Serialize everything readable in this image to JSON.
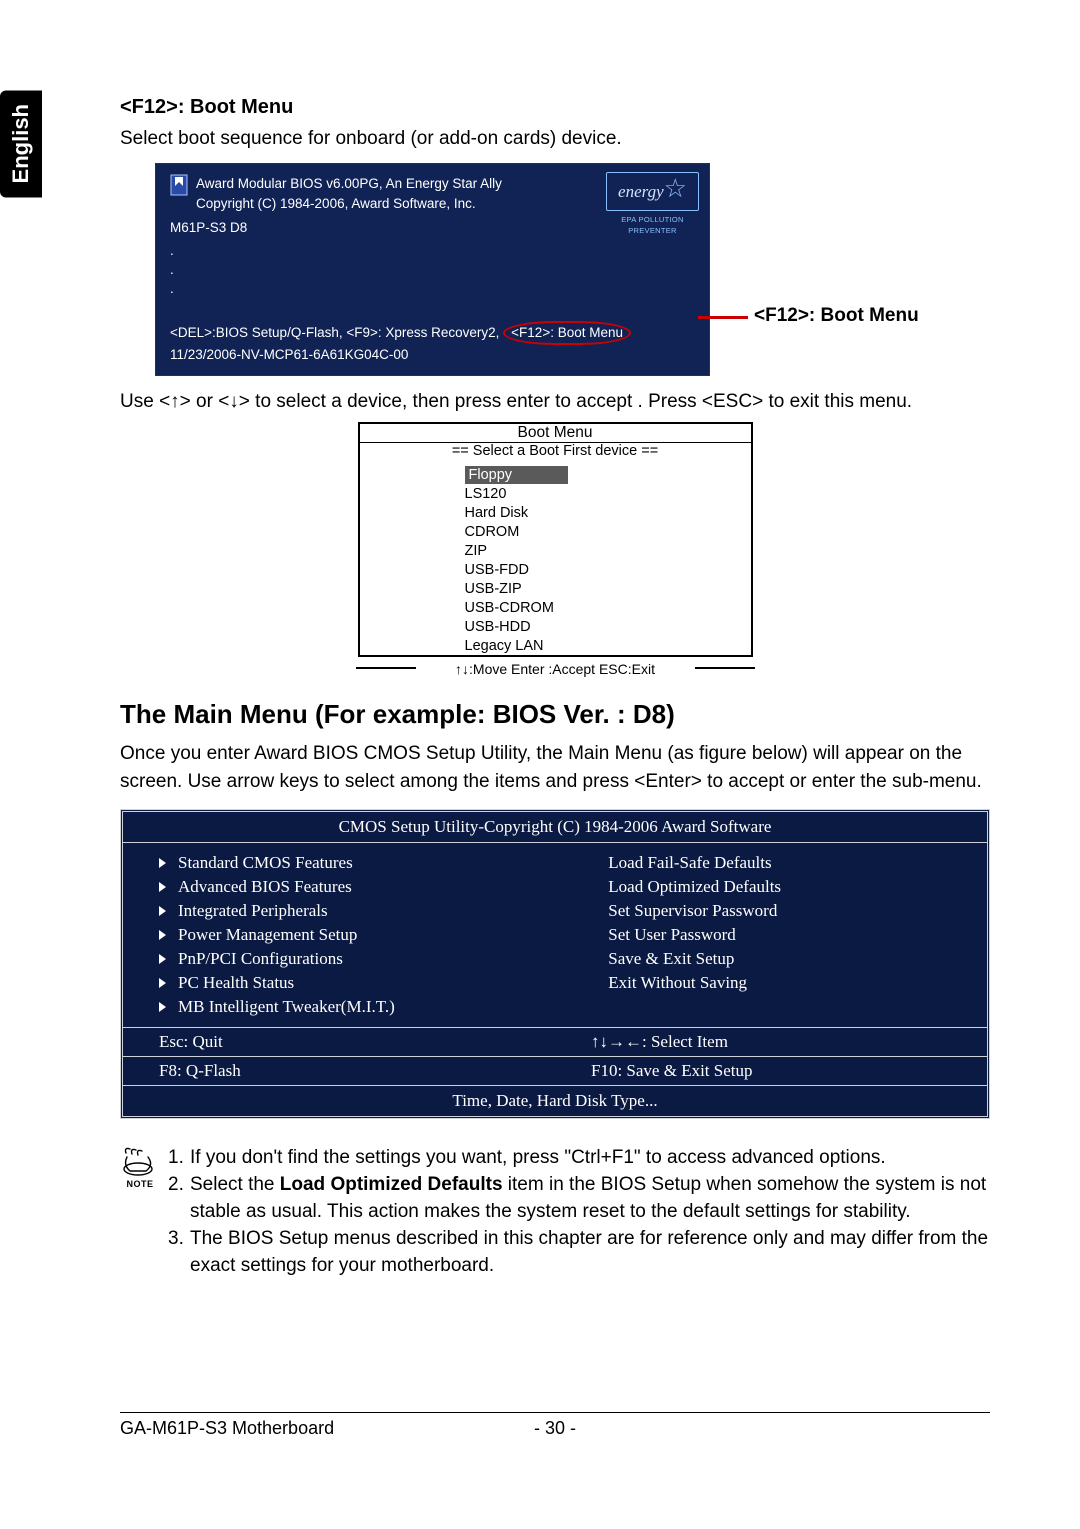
{
  "sideTab": "English",
  "section1": {
    "heading": "<F12>: Boot Menu",
    "text": "Select boot sequence for onboard (or add-on cards) device."
  },
  "post": {
    "line1": "Award Modular BIOS v6.00PG, An Energy Star Ally",
    "line2": "Copyright  (C) 1984-2006, Award Software,  Inc.",
    "model": "M61P-S3 D8",
    "energyCursive": "energy",
    "energyEpa": "EPA  POLLUTION PREVENTER",
    "bottom1a": "<DEL>:BIOS Setup/Q-Flash, <F9>: Xpress Recovery2,",
    "bottom1b": "<F12>: Boot Menu",
    "bottom2": "11/23/2006-NV-MCP61-6A61KG04C-00"
  },
  "callout": "<F12>: Boot Menu",
  "instruction": "Use <↑> or <↓> to select a device, then press enter to accept . Press <ESC> to exit this menu.",
  "bootMenu": {
    "title": "Boot Menu",
    "subtitle": "==  Select a Boot First device  ==",
    "items": [
      "Floppy",
      "LS120",
      "Hard Disk",
      "CDROM",
      "ZIP",
      "USB-FDD",
      "USB-ZIP",
      "USB-CDROM",
      "USB-HDD",
      "Legacy LAN"
    ],
    "footer": "↑↓:Move   Enter :Accept   ESC:Exit"
  },
  "section2": {
    "heading": "The Main Menu (For example: BIOS Ver. : D8)",
    "text": "Once you enter Award BIOS CMOS Setup Utility, the Main Menu (as figure below) will appear on the screen.  Use arrow keys to select among the items and press <Enter> to accept or enter the sub-menu."
  },
  "mainMenu": {
    "title": "CMOS Setup Utility-Copyright (C) 1984-2006 Award Software",
    "left": [
      "Standard CMOS Features",
      "Advanced BIOS Features",
      "Integrated Peripherals",
      "Power Management Setup",
      "PnP/PCI Configurations",
      "PC Health Status",
      "MB Intelligent Tweaker(M.I.T.)"
    ],
    "right": [
      "Load Fail-Safe Defaults",
      "Load Optimized Defaults",
      "Set Supervisor Password",
      "Set User Password",
      "Save & Exit Setup",
      "Exit Without Saving"
    ],
    "help1a": "Esc: Quit",
    "help1b": "↑↓→←: Select Item",
    "help2a": "F8: Q-Flash",
    "help2b": "F10: Save & Exit Setup",
    "desc": "Time, Date, Hard Disk Type..."
  },
  "noteLabel": "NOTE",
  "notes": {
    "n1": "If you don't find the settings you want, press \"Ctrl+F1\" to access advanced options.",
    "n2a": "Select the ",
    "n2bold": "Load Optimized Defaults",
    "n2b": " item in the BIOS Setup when somehow the system is not stable as usual. This action makes the system reset to the default settings for stability.",
    "n3": "The BIOS Setup menus described in this chapter are for reference only and may differ from the exact settings for your motherboard."
  },
  "footer": {
    "left": "GA-M61P-S3 Motherboard",
    "page": "- 30 -"
  }
}
